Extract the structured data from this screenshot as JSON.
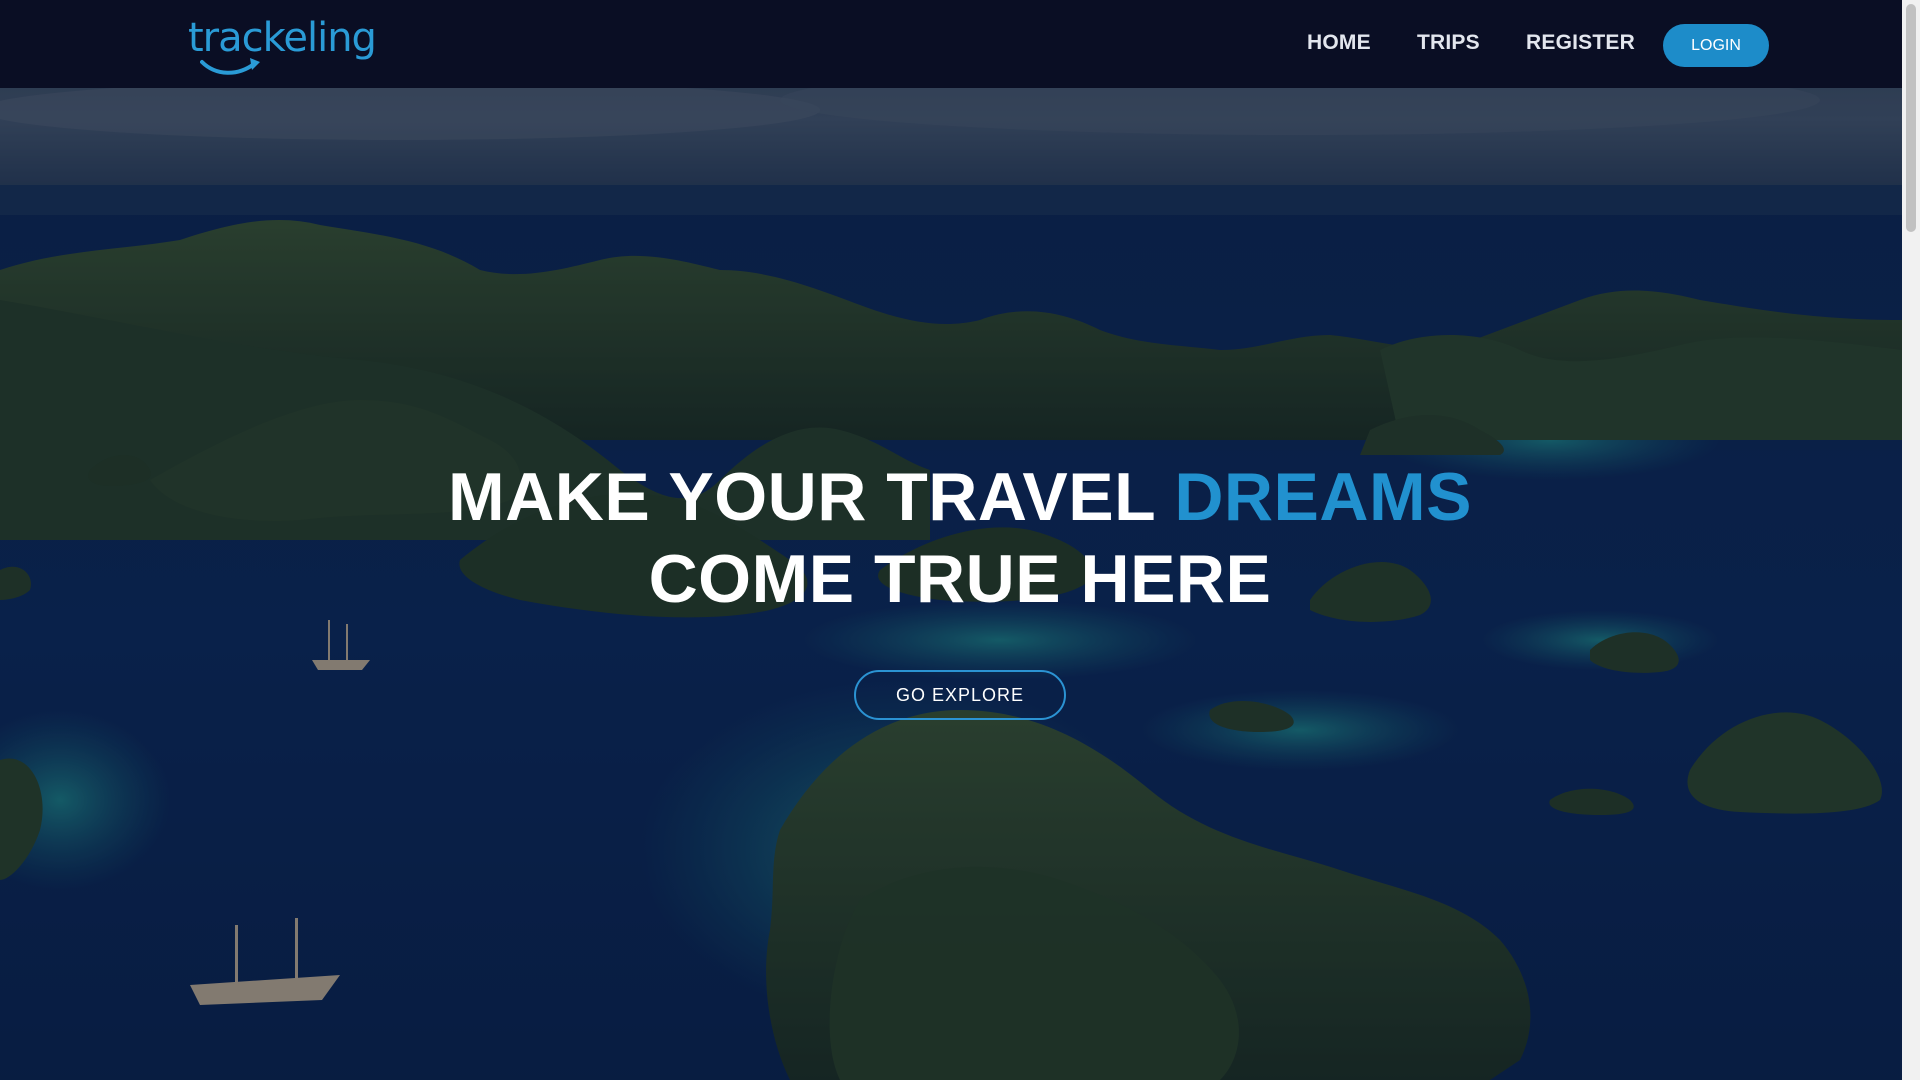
{
  "brand": {
    "name": "trackeling",
    "color": "#2a9bd6"
  },
  "nav": {
    "links": [
      {
        "label": "HOME"
      },
      {
        "label": "TRIPS"
      },
      {
        "label": "REGISTER"
      }
    ],
    "login_label": "LOGIN"
  },
  "hero": {
    "headline_white_1": "MAKE YOUR TRAVEL ",
    "headline_accent": "DREAMS",
    "headline_line_2": "COME TRUE HERE",
    "cta_label": "GO EXPLORE",
    "background": "aerial view of tropical islands"
  },
  "colors": {
    "accent": "#2191cf",
    "navbar_bg": "#0a0e24",
    "button_bg": "#1d8cc9"
  }
}
